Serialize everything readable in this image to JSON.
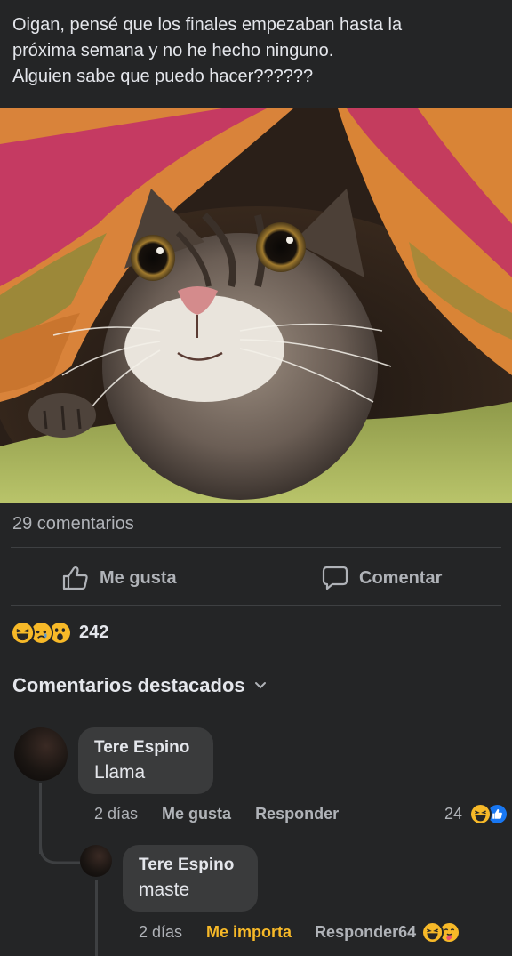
{
  "post": {
    "text_lines": [
      "Oigan, pensé que los finales empezaban hasta la",
      "próxima semana y no he hecho ninguno.",
      "Alguien sabe que puedo hacer??????"
    ]
  },
  "stats": {
    "comments_count": "29 comentarios",
    "reactions_count": "242"
  },
  "actions": {
    "like_label": "Me gusta",
    "comment_label": "Comentar"
  },
  "featured": {
    "title": "Comentarios destacados"
  },
  "comments": [
    {
      "author": "Tere Espino",
      "text": "Llama",
      "time": "2 días",
      "like_label": "Me gusta",
      "reply_label": "Responder",
      "reaction_count": "24"
    },
    {
      "author": "Tere Espino",
      "text": "maste",
      "time": "2 días",
      "like_label": "Me importa",
      "reply_label": "Responder",
      "reaction_count": "64"
    }
  ],
  "colors": {
    "background": "#242526",
    "bubble": "#3a3b3c",
    "secondary_text": "#b0b3b8",
    "me_importa": "#f7b928",
    "like_blue": "#1877f2"
  }
}
